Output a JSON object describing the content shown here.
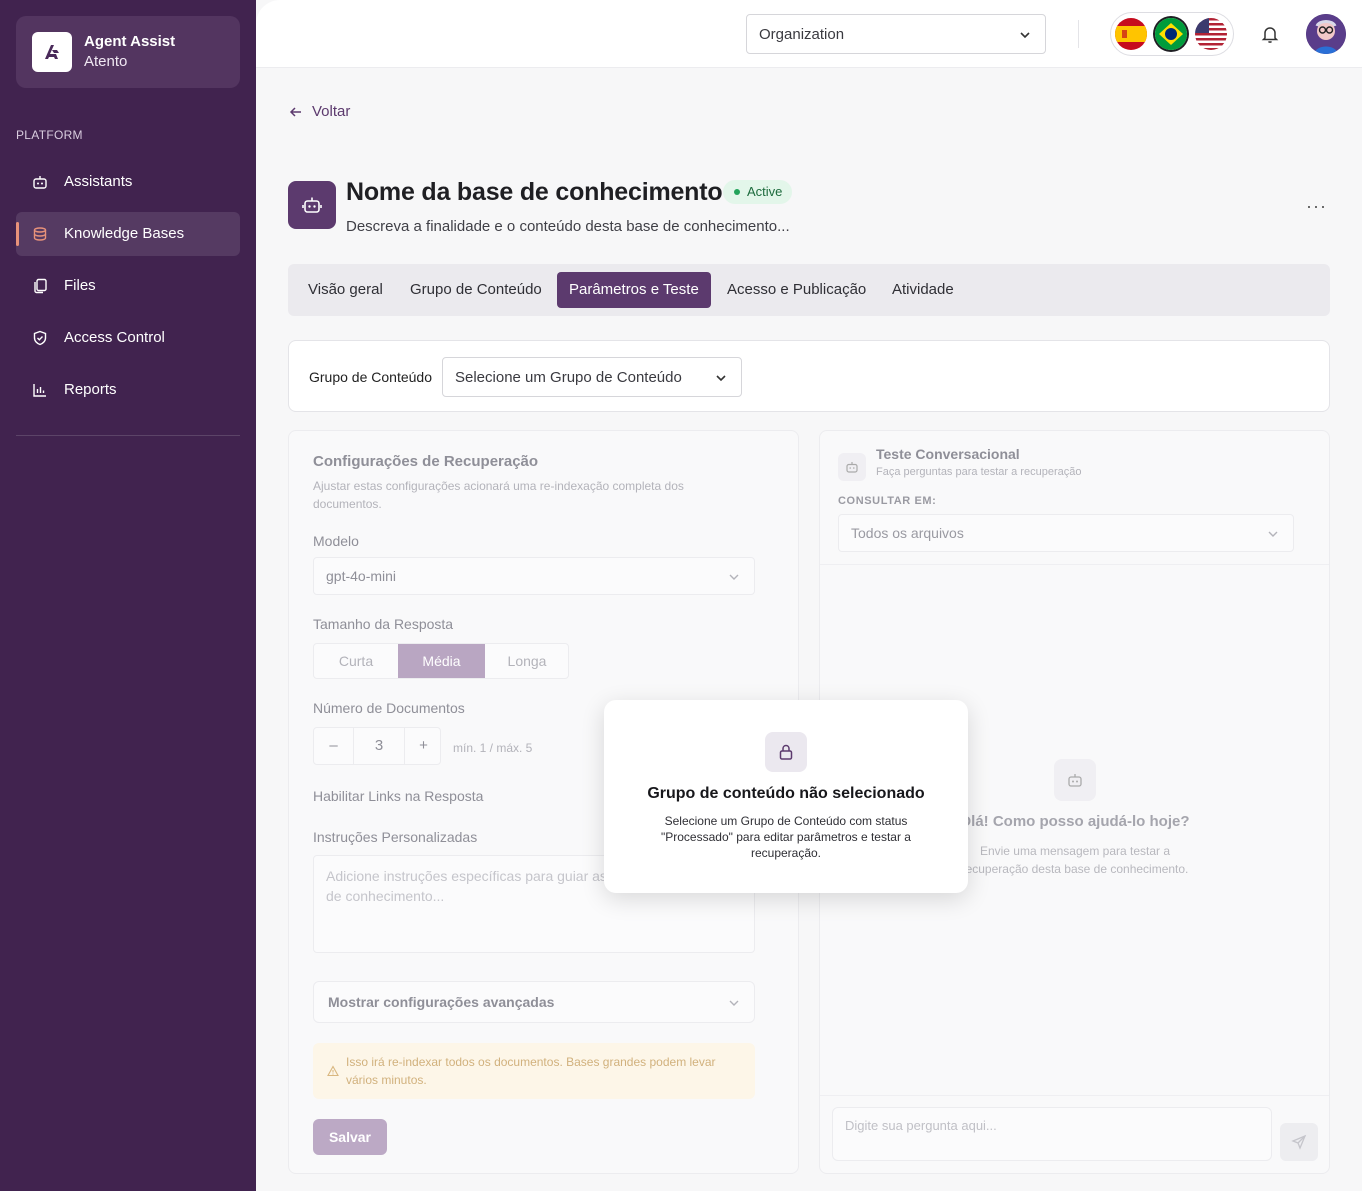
{
  "brand": {
    "title": "Agent Assist",
    "subtitle": "Atento"
  },
  "sidebar": {
    "section_label": "PLATFORM",
    "items": [
      {
        "label": "Assistants",
        "icon": "bot-icon"
      },
      {
        "label": "Knowledge Bases",
        "icon": "database-icon",
        "active": true
      },
      {
        "label": "Files",
        "icon": "files-icon"
      },
      {
        "label": "Access Control",
        "icon": "shield-icon"
      },
      {
        "label": "Reports",
        "icon": "chart-icon"
      }
    ]
  },
  "topbar": {
    "org_select": "Organization",
    "languages": [
      "es",
      "pt-BR",
      "en-US"
    ]
  },
  "page": {
    "back_label": "Voltar",
    "title": "Nome da base de conhecimento",
    "status": "Active",
    "description": "Descreva a finalidade e o conteúdo desta base de conhecimento...",
    "more": "···"
  },
  "tabs": [
    {
      "label": "Visão geral"
    },
    {
      "label": "Grupo de Conteúdo"
    },
    {
      "label": "Parâmetros e Teste",
      "active": true
    },
    {
      "label": "Acesso e Publicação"
    },
    {
      "label": "Atividade"
    }
  ],
  "group": {
    "label": "Grupo de Conteúdo",
    "placeholder": "Selecione um Grupo de Conteúdo"
  },
  "retrieval": {
    "title": "Configurações de Recuperação",
    "hint": "Ajustar estas configurações acionará uma re-indexação completa dos documentos.",
    "model_label": "Modelo",
    "model_value": "gpt-4o-mini",
    "size_label": "Tamanho da Resposta",
    "sizes": [
      "Curta",
      "Média",
      "Longa"
    ],
    "size_selected": "Média",
    "docs_label": "Número de Documentos",
    "docs_minus": "–",
    "docs_value": "3",
    "docs_plus": "+",
    "docs_hint": "mín. 1 / máx. 5",
    "links_label": "Habilitar Links na Resposta",
    "instructions_label": "Instruções Personalizadas",
    "instructions_placeholder": "Adicione instruções específicas para guiar as respostas desta base de conhecimento...",
    "advanced_label": "Mostrar configurações avançadas",
    "warning": "Isso irá re-indexar todos os documentos. Bases grandes podem levar vários minutos.",
    "save_label": "Salvar"
  },
  "chat": {
    "title": "Teste Conversacional",
    "subtitle": "Faça perguntas para testar a recuperação",
    "consult_label": "CONSULTAR EM:",
    "consult_value": "Todos os arquivos",
    "hello": "Olá! Como posso ajudá-lo hoje?",
    "help": "Envie uma mensagem para testar a recuperação desta base de conhecimento.",
    "input_placeholder": "Digite sua pergunta aqui..."
  },
  "modal": {
    "title": "Grupo de conteúdo não selecionado",
    "text": "Selecione um Grupo de Conteúdo com status \"Processado\" para editar parâmetros e testar a recuperação."
  },
  "colors": {
    "sidebar_bg": "#41234f",
    "accent": "#5c3a6e",
    "active_indicator": "#e8927a",
    "status_green": "#22a35a"
  }
}
